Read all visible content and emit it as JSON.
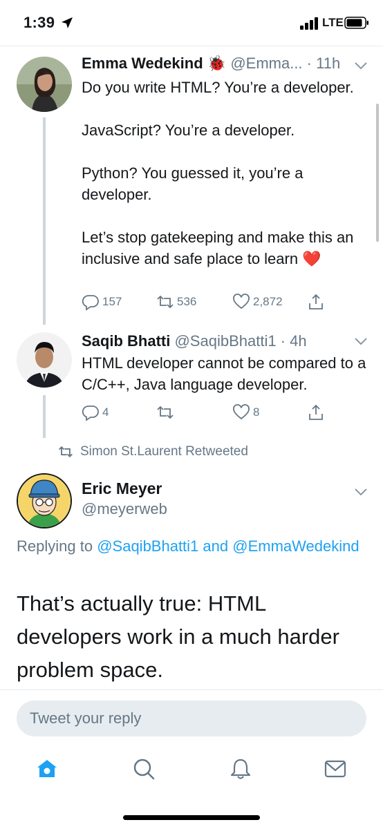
{
  "status": {
    "time": "1:39",
    "network": "LTE"
  },
  "thread": [
    {
      "name": "Emma Wedekind",
      "emoji": "🐞",
      "handle": "@Emma...",
      "time": "11h",
      "body": [
        "Do you write HTML? You’re a developer.",
        "JavaScript? You’re a developer.",
        "Python? You guessed it, you’re a developer.",
        "Let’s stop gatekeeping and make this an inclusive and safe place to learn ❤️"
      ],
      "replies": "157",
      "retweets": "536",
      "likes": "2,872"
    },
    {
      "name": "Saqib Bhatti",
      "handle": "@SaqibBhatti1",
      "time": "4h",
      "body": [
        "HTML developer cannot be compared to a C/C++, Java language developer."
      ],
      "replies": "4",
      "retweets": "",
      "likes": "8"
    }
  ],
  "retweet_notice": "Simon St.Laurent Retweeted",
  "main_tweet": {
    "name": "Eric Meyer",
    "handle": "@meyerweb",
    "replying_prefix": "Replying to",
    "replying_user1": "@SaqibBhatti1",
    "replying_and": "and",
    "replying_user2": "@EmmaWedekind",
    "text": "That’s actually true: HTML developers work in a much harder problem space."
  },
  "reply_box": {
    "placeholder": "Tweet your reply"
  },
  "tabs": [
    "home-icon",
    "search-icon",
    "notifications-icon",
    "messages-icon"
  ],
  "colors": {
    "accent": "#1da1f2",
    "muted": "#657786",
    "divider": "#e6ecf0",
    "text": "#14171a"
  }
}
